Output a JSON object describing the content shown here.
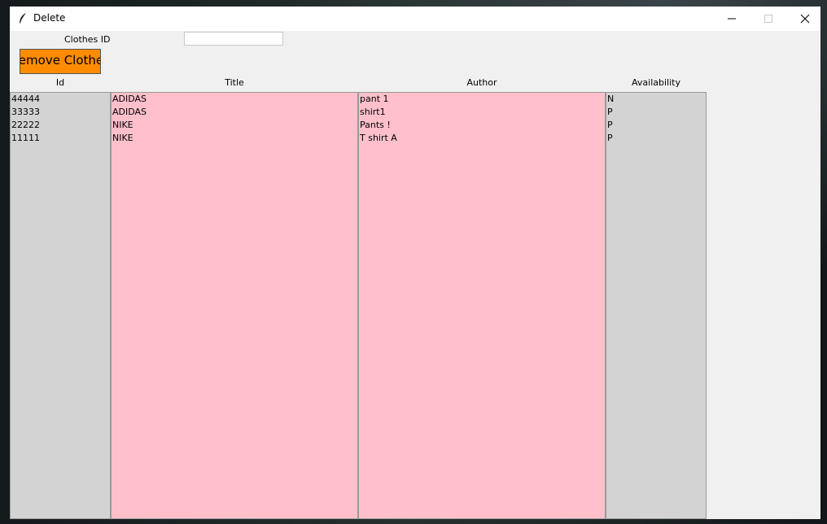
{
  "window": {
    "title": "Delete"
  },
  "form": {
    "clothes_id_label": "Clothes ID",
    "clothes_id_value": "",
    "remove_button": "Remove Clothes"
  },
  "table": {
    "headers": {
      "id": "Id",
      "title": "Title",
      "author": "Author",
      "availability": "Availability"
    },
    "ids": [
      "44444",
      "33333",
      "22222",
      "11111"
    ],
    "titles": [
      "ADIDAS",
      "ADIDAS",
      "NIKE",
      "NIKE"
    ],
    "authors": [
      "pant 1",
      "shirt1",
      "Pants !",
      "T shirt A"
    ],
    "availability": [
      "N",
      "P",
      "P",
      "P"
    ]
  },
  "colors": {
    "button": "#ff8c00",
    "grey_list": "#d3d3d3",
    "pink_list": "#ffc0cb"
  }
}
